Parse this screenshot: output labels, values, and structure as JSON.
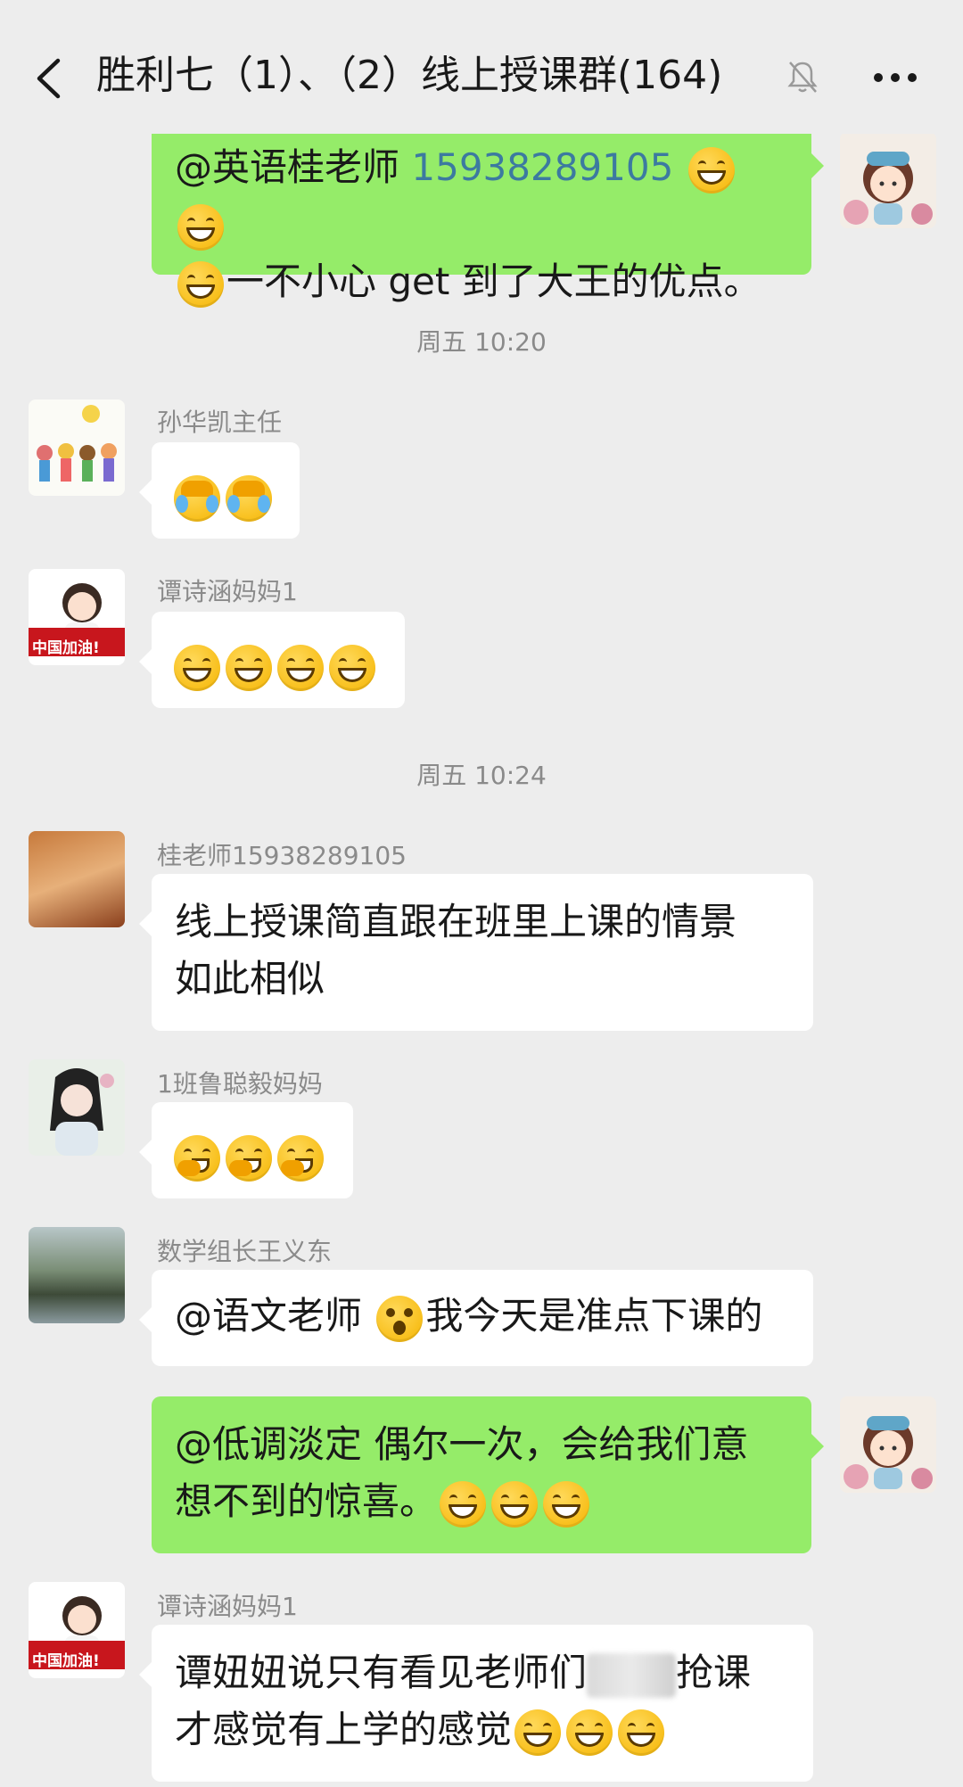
{
  "header": {
    "title": "胜利七（1）、（2）线上授课群(164)"
  },
  "messages": [
    {
      "direction": "out",
      "text_mention": "@英语桂老师",
      "text_number": "15938289105",
      "text_after": "一不小心 get 到了大王的优点。"
    },
    {
      "type": "time",
      "text": "周五 10:20"
    },
    {
      "direction": "in",
      "sender": "孙华凯主任",
      "emoji": [
        "cry",
        "cry"
      ]
    },
    {
      "direction": "in",
      "sender": "谭诗涵妈妈1",
      "avatar_badge": "中国加油!",
      "emoji": [
        "grin",
        "grin",
        "grin",
        "grin"
      ]
    },
    {
      "type": "time",
      "text": "周五 10:24"
    },
    {
      "direction": "in",
      "sender": "桂老师15938289105",
      "text_line1": "线上授课简直跟在班里上课的情景",
      "text_line2": "如此相似"
    },
    {
      "direction": "in",
      "sender": "1班鲁聪毅妈妈",
      "emoji": [
        "chuckle",
        "chuckle",
        "chuckle"
      ]
    },
    {
      "direction": "in",
      "sender": "数学组长王义东",
      "text_before": "@语文老师",
      "text_after": "我今天是准点下课的"
    },
    {
      "direction": "out",
      "text_line1": "@低调淡定  偶尔一次，会给我们意",
      "text_line2": "想不到的惊喜。"
    },
    {
      "direction": "in",
      "sender": "谭诗涵妈妈1",
      "avatar_badge": "中国加油!",
      "text_line1_before": "谭妞妞说只有看见老师们",
      "text_line1_after": "抢课",
      "text_line2": "才感觉有上学的感觉"
    }
  ]
}
